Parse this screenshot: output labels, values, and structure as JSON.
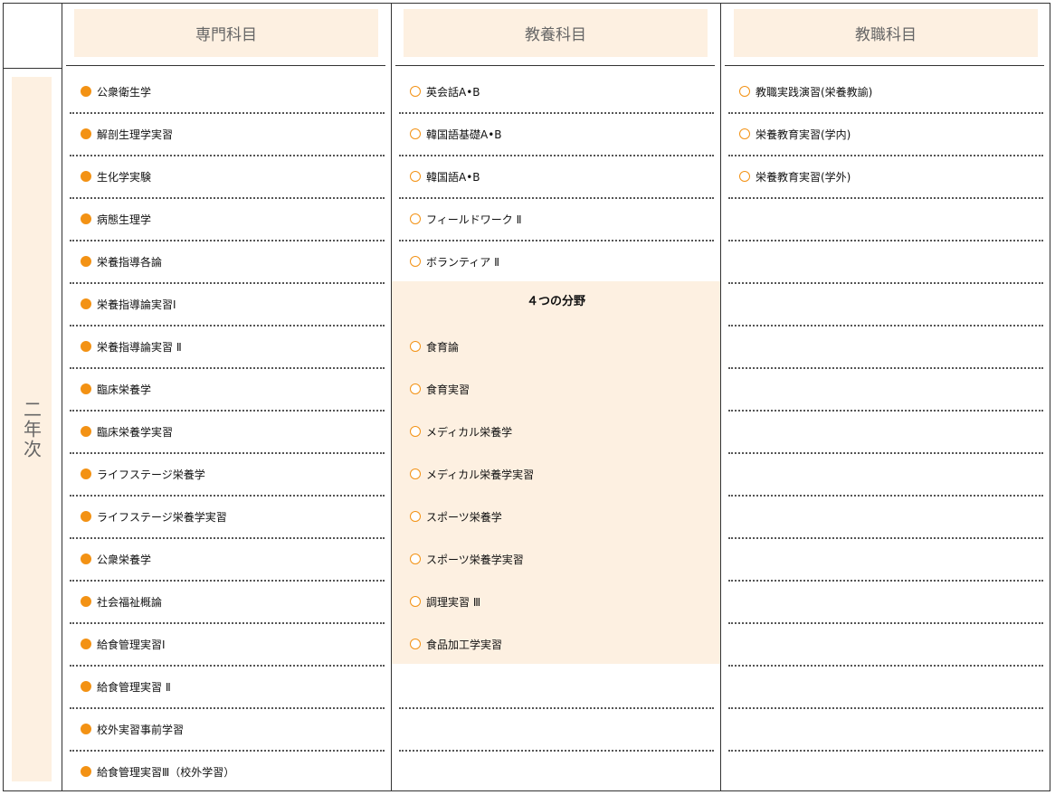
{
  "year_label": "二年次",
  "columns": {
    "senmon": {
      "title": "専門科目"
    },
    "kyoyo": {
      "title": "教養科目"
    },
    "kyoshoku": {
      "title": "教職科目"
    }
  },
  "senmon_items": [
    "公衆衛生学",
    "解剖生理学実習",
    "生化学実験",
    "病態生理学",
    "栄養指導各論",
    "栄養指導論実習Ⅰ",
    "栄養指導論実習 Ⅱ",
    "臨床栄養学",
    "臨床栄養学実習",
    "ライフステージ栄養学",
    "ライフステージ栄養学実習",
    "公衆栄養学",
    "社会福祉概論",
    "給食管理実習Ⅰ",
    "給食管理実習 Ⅱ",
    "校外実習事前学習",
    "給食管理実習Ⅲ（校外学習）"
  ],
  "kyoyo_items": [
    "英会話A•B",
    "韓国語基礎A•B",
    "韓国語A•B",
    "フィールドワーク Ⅱ",
    "ボランティア Ⅱ"
  ],
  "four_fields": {
    "title": "４つの分野",
    "items": [
      "食育論",
      "食育実習",
      "メディカル栄養学",
      "メディカル栄養学実習",
      "スポーツ栄養学",
      "スポーツ栄養学実習",
      "調理実習 Ⅲ",
      "食品加工学実習"
    ]
  },
  "kyoshoku_items": [
    "教職実践演習(栄養教諭)",
    "栄養教育実習(学内)",
    "栄養教育実習(学外)"
  ],
  "colors": {
    "accent": "#f39214",
    "header_bg": "#fdf0e1",
    "border": "#333333"
  }
}
